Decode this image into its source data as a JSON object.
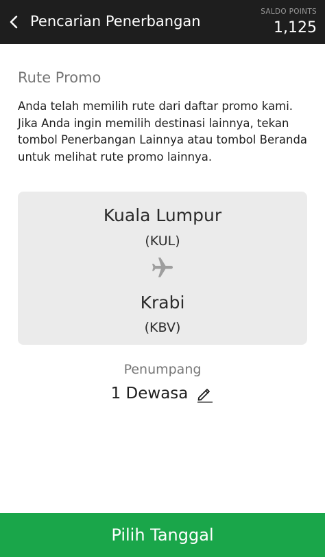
{
  "header": {
    "back_icon": "chevron-left-icon",
    "title": "Pencarian Penerbangan",
    "points_label": "SALDO POINTS",
    "points_value": "1,125"
  },
  "promo": {
    "section_title": "Rute Promo",
    "description": "Anda telah memilih rute dari daftar promo kami. Jika Anda ingin memilih destinasi lainnya, tekan tombol Penerbangan Lainnya atau tombol Beranda untuk melihat rute promo lainnya."
  },
  "route": {
    "origin_city": "Kuala Lumpur",
    "origin_code": "(KUL)",
    "destination_city": "Krabi",
    "destination_code": "(KBV)",
    "icon": "airplane-icon"
  },
  "passenger": {
    "label": "Penumpang",
    "value": "1 Dewasa",
    "edit_icon": "pencil-icon"
  },
  "cta": {
    "label": "Pilih Tanggal"
  },
  "colors": {
    "header_bg": "#1e1e1e",
    "card_bg": "#ebebeb",
    "cta_bg": "#1aa64a",
    "muted_text": "#757575"
  }
}
